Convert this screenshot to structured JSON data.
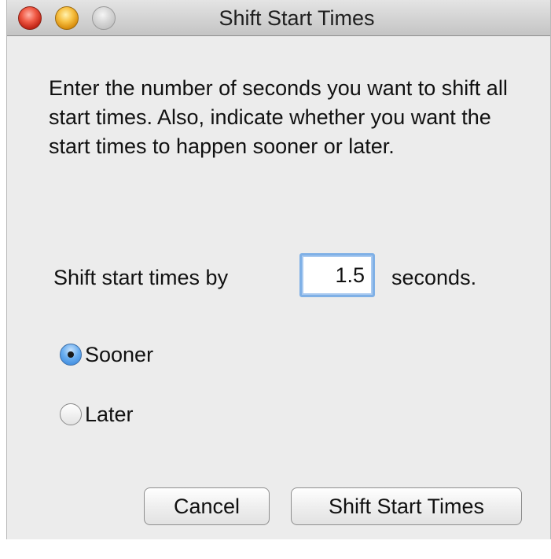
{
  "window": {
    "title": "Shift Start Times"
  },
  "dialog": {
    "instructions": "Enter the number of seconds you want to shift all start times. Also, indicate whether you want the start times to happen sooner or later.",
    "shift_label": "Shift start times by",
    "shift_value": "1.5",
    "seconds_label": "seconds.",
    "direction": {
      "options": [
        {
          "label": "Sooner",
          "selected": true
        },
        {
          "label": "Later",
          "selected": false
        }
      ]
    }
  },
  "buttons": {
    "cancel_label": "Cancel",
    "confirm_label": "Shift Start Times"
  },
  "icons": {
    "close": "close-icon",
    "minimize": "minimize-icon",
    "zoom": "zoom-icon"
  },
  "colors": {
    "window_bg": "#ececec",
    "focus_ring": "#7fb0e6",
    "radio_selected": "#2f7fd8"
  }
}
